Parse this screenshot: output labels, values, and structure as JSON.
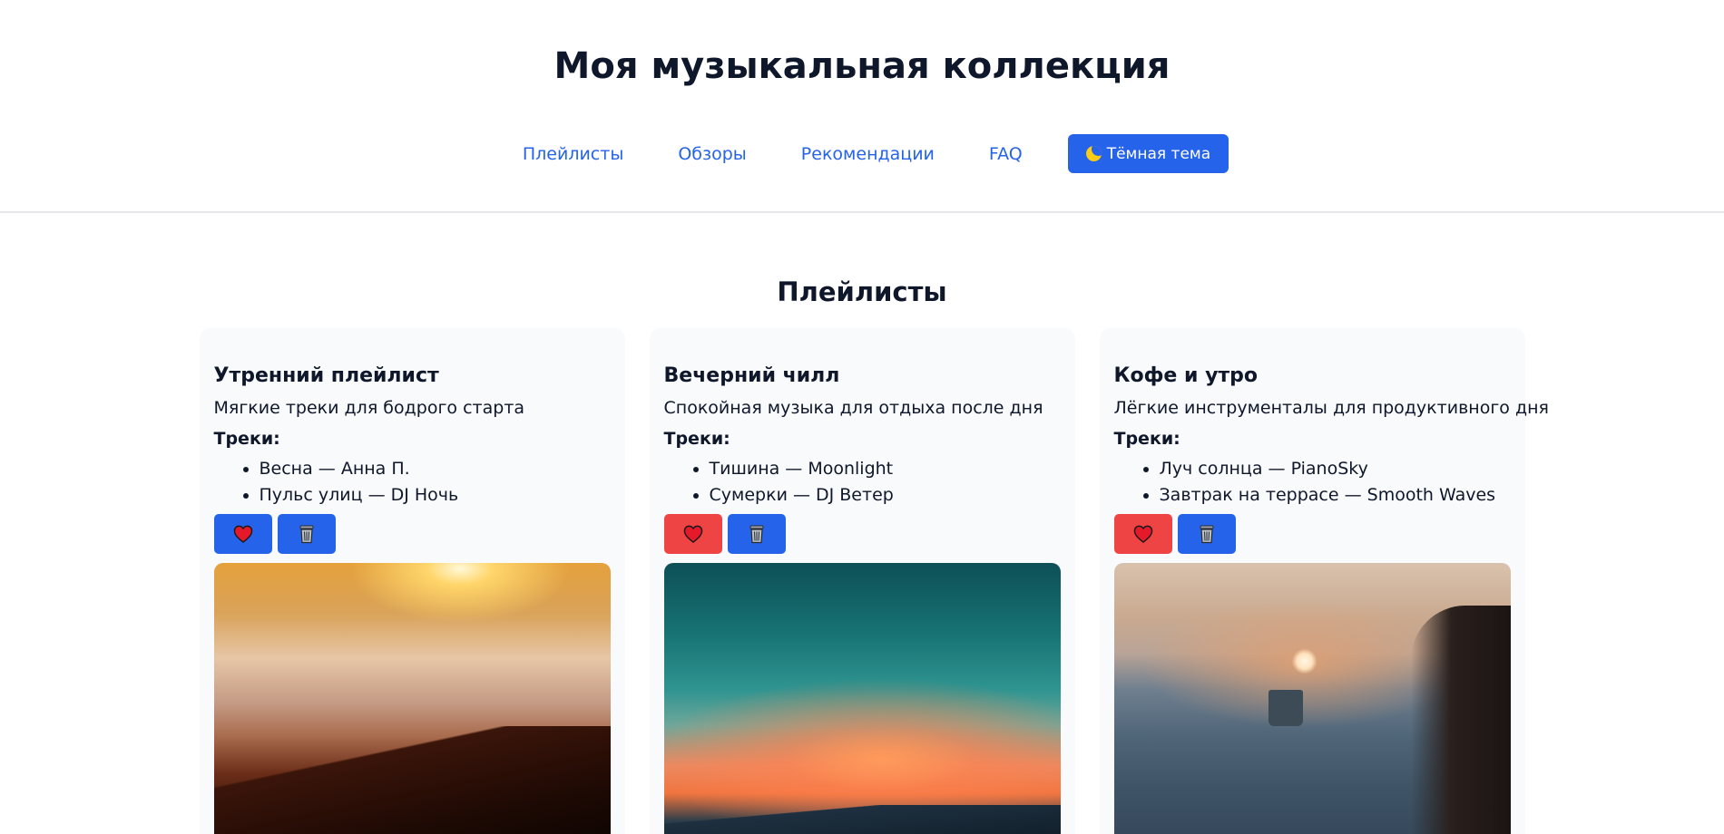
{
  "header": {
    "title": "Моя музыкальная коллекция",
    "nav": [
      {
        "label": "Плейлисты"
      },
      {
        "label": "Обзоры"
      },
      {
        "label": "Рекомендации"
      },
      {
        "label": "FAQ"
      }
    ],
    "theme_button": {
      "label": "Тёмная тема",
      "icon": "moon-icon"
    }
  },
  "section": {
    "title": "Плейлисты"
  },
  "playlists": [
    {
      "title": "Утренний плейлист",
      "description": "Мягкие треки для бодрого старта",
      "tracks_label": "Треки:",
      "tracks": [
        "Весна — Анна П.",
        "Пульс улиц — DJ Ночь"
      ],
      "liked": false,
      "cover": "sunrise-over-clouds"
    },
    {
      "title": "Вечерний чилл",
      "description": "Спокойная музыка для отдыха после дня",
      "tracks_label": "Треки:",
      "tracks": [
        "Тишина — Moonlight",
        "Сумерки — DJ Ветер"
      ],
      "liked": true,
      "cover": "sunset-sky"
    },
    {
      "title": "Кофе и утро",
      "description": "Лёгкие инструменталы для продуктивного дня",
      "tracks_label": "Треки:",
      "tracks": [
        "Луч солнца — PianoSky",
        "Завтрак на террасе — Smooth Waves"
      ],
      "liked": true,
      "cover": "coffee-mug-at-sunrise"
    }
  ],
  "icons": {
    "like": "heart-icon",
    "delete": "trash-icon"
  },
  "colors": {
    "accent": "#2563eb",
    "liked": "#ef4444",
    "card_bg": "#f8fafc",
    "text": "#0f172a"
  }
}
